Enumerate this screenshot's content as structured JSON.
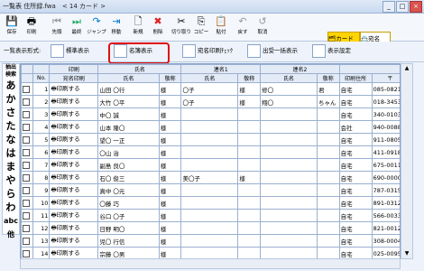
{
  "window": {
    "title": "一覧表 住所録.fwa",
    "subtitle": "< 14 カード >",
    "controls": [
      "_",
      "□",
      "×"
    ]
  },
  "toolbar": {
    "buttons": [
      "保存",
      "印刷",
      "先頭",
      "最終",
      "ジャンプ",
      "移動",
      "新規",
      "削除",
      "切り取り",
      "コピー",
      "貼付",
      "戻す",
      "取消"
    ],
    "card_toggle": "カード",
    "name_toggle": "宛名"
  },
  "view_bar": {
    "label": "一覧表示形式:",
    "standard": "標準表示",
    "name_view": "名簿表示",
    "check": "宛名印刷ﾁｪｯｸ",
    "outgoing": "出受一括表示",
    "settings": "表示設定"
  },
  "index": {
    "top": "抽出",
    "search": "検索",
    "kana": [
      "あ",
      "か",
      "さ",
      "た",
      "な",
      "は",
      "ま",
      "や",
      "ら",
      "わ"
    ],
    "abc": "abc",
    "other": "他"
  },
  "table": {
    "group_headers": [
      "印刷",
      "氏名",
      "連名1",
      "連名2"
    ],
    "headers": [
      "No.",
      "宛名印刷",
      "氏名",
      "敬称",
      "氏名",
      "敬称",
      "氏名",
      "敬称",
      "印刷住所",
      "〒",
      "住所"
    ],
    "rows": [
      {
        "no": "1",
        "print": "印刷する",
        "name": "山田 〇行",
        "k1": "様",
        "r1": "〇子",
        "k2": "様",
        "r2": "修〇",
        "k3": "君",
        "addr": "自宅",
        "zip": "085-0821",
        "adr": "北海道釧路"
      },
      {
        "no": "2",
        "print": "印刷する",
        "name": "大竹 〇平",
        "k1": "様",
        "r1": "〇子",
        "k2": "様",
        "r2": "翔〇",
        "k3": "ちゃん",
        "addr": "自宅",
        "zip": "018-3453",
        "adr": "秋田県北秋"
      },
      {
        "no": "3",
        "print": "印刷する",
        "name": "中〇 誠",
        "k1": "様",
        "r1": "",
        "k2": "",
        "r2": "",
        "k3": "",
        "addr": "自宅",
        "zip": "340-0103",
        "adr": "埼玉県幸手"
      },
      {
        "no": "4",
        "print": "印刷する",
        "name": "山本 隆〇",
        "k1": "様",
        "r1": "",
        "k2": "",
        "r2": "",
        "k3": "",
        "addr": "会社",
        "zip": "940-0088",
        "adr": "新潟県長岡"
      },
      {
        "no": "5",
        "print": "印刷する",
        "name": "望〇 一正",
        "k1": "様",
        "r1": "",
        "k2": "",
        "r2": "",
        "k3": "",
        "addr": "自宅",
        "zip": "911-0805",
        "adr": "福井県勝山"
      },
      {
        "no": "6",
        "print": "印刷する",
        "name": "〇山 治",
        "k1": "様",
        "r1": "",
        "k2": "",
        "r2": "",
        "k3": "",
        "addr": "自宅",
        "zip": "411-0918",
        "adr": "静岡県駿東"
      },
      {
        "no": "7",
        "print": "印刷する",
        "name": "副島 良〇",
        "k1": "様",
        "r1": "",
        "k2": "",
        "r2": "",
        "k3": "",
        "addr": "自宅",
        "zip": "675-0011",
        "adr": "兵庫県加古"
      },
      {
        "no": "8",
        "print": "印刷する",
        "name": "石〇 俊三",
        "k1": "様",
        "r1": "美〇子",
        "k2": "様",
        "r2": "",
        "k3": "",
        "addr": "自宅",
        "zip": "690-0000",
        "adr": "島根県松江"
      },
      {
        "no": "9",
        "print": "印刷する",
        "name": "真中 〇元",
        "k1": "様",
        "r1": "",
        "k2": "",
        "r2": "",
        "k3": "",
        "addr": "自宅",
        "zip": "787-0315",
        "adr": "高知県土佐"
      },
      {
        "no": "10",
        "print": "印刷する",
        "name": "〇藤 巧",
        "k1": "様",
        "r1": "",
        "k2": "",
        "r2": "",
        "k3": "",
        "addr": "自宅",
        "zip": "891-0312",
        "adr": "鹿児島県指"
      },
      {
        "no": "11",
        "print": "印刷する",
        "name": "谷口 〇子",
        "k1": "様",
        "r1": "",
        "k2": "",
        "r2": "",
        "k3": "",
        "addr": "自宅",
        "zip": "566-0033",
        "adr": "大阪府摂津"
      },
      {
        "no": "12",
        "print": "印刷する",
        "name": "日野 明〇",
        "k1": "様",
        "r1": "",
        "k2": "",
        "r2": "",
        "k3": "",
        "addr": "自宅",
        "zip": "821-0012",
        "adr": "福岡県嘉麻"
      },
      {
        "no": "13",
        "print": "印刷する",
        "name": "児〇 行信",
        "k1": "様",
        "r1": "",
        "k2": "",
        "r2": "",
        "k3": "",
        "addr": "自宅",
        "zip": "308-0004",
        "adr": "茨城県筑西"
      },
      {
        "no": "14",
        "print": "印刷する",
        "name": "宗藤 〇男",
        "k1": "様",
        "r1": "",
        "k2": "",
        "r2": "",
        "k3": "",
        "addr": "自宅",
        "zip": "025-0095",
        "adr": "岩手県花巻"
      }
    ],
    "new_row": "新規"
  }
}
